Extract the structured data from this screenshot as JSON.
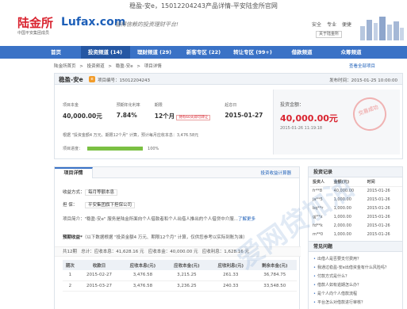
{
  "window_title": "稳盈-安e，15012204243产品详情-平安陆金所官网",
  "header": {
    "logo_cn": "陆金所",
    "logo_en": "Lufax.com",
    "logo_sub": "中国平安集团成员",
    "slogan": "值得信赖的投资理财平台!",
    "top_links": [
      "安全",
      "专业",
      "便捷"
    ],
    "about": "关于陆金所"
  },
  "nav": {
    "items": [
      {
        "label": "首页"
      },
      {
        "label": "投资频道 (14)"
      },
      {
        "label": "理财频道 (29)"
      },
      {
        "label": "新客专区 (22)"
      },
      {
        "label": "转让专区 (99+)"
      },
      {
        "label": "借款频道"
      },
      {
        "label": "众筹频道"
      }
    ],
    "active_index": 1
  },
  "breadcrumb": [
    "陆金所首页",
    ">",
    "投资频道",
    ">",
    "稳盈-安e",
    ">",
    "项目详情"
  ],
  "breadcrumb_right": "查看全部项目",
  "product": {
    "name": "稳盈-安e",
    "badge": "e",
    "id_text": "项目编号：15012204243",
    "publish_time": "发布时间：2015-01-25 10:00:00",
    "stats": [
      {
        "label": "项目本金",
        "value": "40,000.00元"
      },
      {
        "label": "预期年化利率",
        "value": "7.84%"
      },
      {
        "label": "期限",
        "value": "12个月",
        "tag": "持有60天即可转让"
      },
      {
        "label": "起息日",
        "value": "2015-01-27"
      }
    ],
    "calc_note": "根据 \"投资金额4 万元、期限12个月\" 计算，预计每月应收本息：3,476.58元",
    "progress_label": "项目进度：",
    "progress_pct": 100,
    "progress_text": "100%",
    "invest_label": "投资金额：",
    "invest_amount": "40,000.00元",
    "invest_time": "2015-01-26 11:19:18",
    "stamp_text": "交易成功"
  },
  "detail": {
    "tab": "项目详情",
    "tab_link": "投资收益计算器",
    "repay_label": "收益方式：",
    "repay_value": "每月等额本息",
    "guarantee_label": "担   保：",
    "guarantee_value": "平安集团旗下担保公司",
    "intro_label": "项目简介：",
    "intro_text": "\"稳盈-安e\" 服务是陆金所面向个人借款者和个人出借人推出的个人借贷中介服...",
    "intro_more": "了解更多",
    "expected_title": "预期收益*",
    "expected_note": "（以下数据根据 \"投资金额4 万元、期限12个月\" 计算，仅供您参考以实际到账为准）",
    "summary_a": "共12期",
    "summary_b": "总计：应收本息：41,628.16 元",
    "summary_c": "应收本金：40,000.00 元",
    "summary_d": "应收利息：1,628.16 元",
    "table": {
      "headers": [
        "期次",
        "收款日",
        "应收本息(元)",
        "应收本金(元)",
        "应收利息(元)",
        "剩余本金(元)"
      ],
      "rows": [
        [
          "1",
          "2015-02-27",
          "3,476.58",
          "3,215.25",
          "261.33",
          "36,784.75"
        ],
        [
          "2",
          "2015-03-27",
          "3,476.58",
          "3,236.25",
          "240.33",
          "33,548.50"
        ]
      ]
    }
  },
  "record": {
    "title": "投资记录",
    "headers": [
      "投资人",
      "金额(元)",
      "时间"
    ],
    "rows": [
      [
        "fr**8",
        "40,000.00",
        "2015-01-26"
      ],
      [
        "ja**5",
        "1,000.00",
        "2015-01-26"
      ],
      [
        "bq**r",
        "1,000.00",
        "2015-01-26"
      ],
      [
        "gj**x",
        "1,000.00",
        "2015-01-26"
      ],
      [
        "fd**k",
        "2,000.00",
        "2015-01-26"
      ],
      [
        "m**0",
        "1,000.00",
        "2015-01-26"
      ]
    ]
  },
  "faq": {
    "title": "常见问题",
    "items": [
      "出借人是否要支付费用？",
      "我通过稳盈-安e出借资金有什么风险吗？",
      "付款方式是什么？",
      "借款人如有逾期怎么办？",
      "是个人向个人借款流程",
      "平台怎么对借款进行审核？"
    ]
  },
  "watermark": "爱网贷加油",
  "colors": {
    "brand_red": "#d9232f",
    "nav_blue": "#3a72c6",
    "link_blue": "#1d5fb8",
    "progress_green": "#7bc043"
  }
}
